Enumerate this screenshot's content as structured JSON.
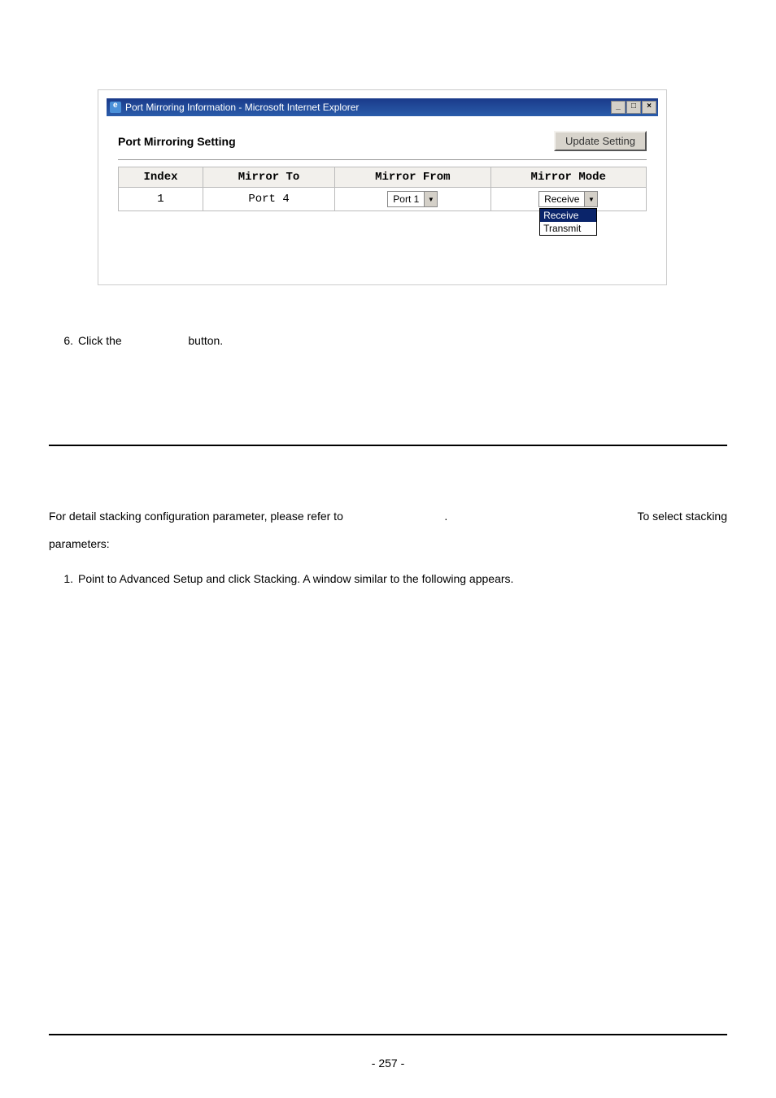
{
  "window": {
    "title": "Port Mirroring Information - Microsoft Internet Explorer",
    "min_label": "_",
    "max_label": "□",
    "close_label": "×"
  },
  "panel": {
    "heading": "Port Mirroring Setting",
    "update_button": "Update Setting"
  },
  "table": {
    "headers": {
      "index": "Index",
      "mirror_to": "Mirror To",
      "mirror_from": "Mirror From",
      "mirror_mode": "Mirror Mode"
    },
    "row": {
      "index": "1",
      "mirror_to": "Port 4",
      "mirror_from_selected": "Port 1",
      "mirror_mode_selected": "Receive",
      "mode_options": {
        "opt1": "Receive",
        "opt2": "Transmit"
      }
    }
  },
  "steps": {
    "s6_num": "6.",
    "s6_pre": "Click the",
    "s6_post": "button.",
    "body_pre": "For detail stacking configuration parameter, please refer to",
    "body_dot": ".",
    "body_right": "To select stacking",
    "body_param": "parameters:",
    "s1_num": "1.",
    "s1_text": "Point to Advanced Setup and click Stacking. A window similar to the following appears."
  },
  "page_number": "- 257 -"
}
